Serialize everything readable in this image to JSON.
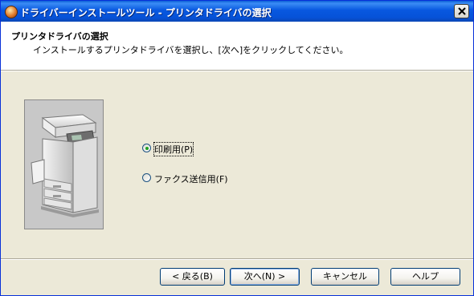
{
  "window": {
    "title": "ドライバーインストールツール - プリンタドライバの選択"
  },
  "header": {
    "title": "プリンタドライバの選択",
    "subtitle": "インストールするプリンタドライバを選択し、[次へ]をクリックしてください。"
  },
  "options": [
    {
      "label": "印刷用(P)",
      "selected": true
    },
    {
      "label": "ファクス送信用(F)",
      "selected": false
    }
  ],
  "buttons": {
    "back": "< 戻る(B)",
    "next": "次へ(N) >",
    "cancel": "キャンセル",
    "help": "ヘルプ"
  },
  "icons": [
    "app-icon",
    "close-icon",
    "printer-illustration"
  ]
}
